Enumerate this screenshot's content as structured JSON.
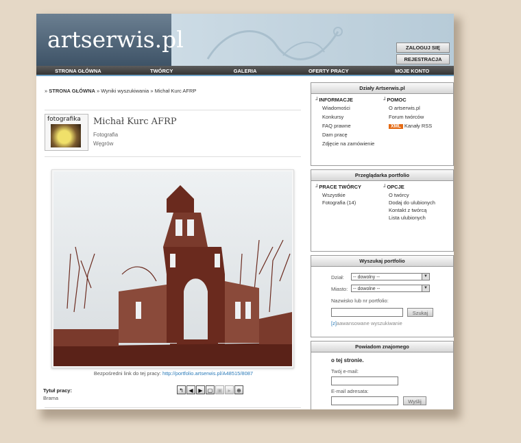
{
  "header": {
    "logo": "artserwis.pl",
    "login_button": "ZALOGUJ SIĘ",
    "register_button": "REJESTRACJA"
  },
  "nav": [
    "STRONA GŁÓWNA",
    "TWÓRCY",
    "GALERIA",
    "OFERTY PRACY",
    "MOJE KONTO"
  ],
  "breadcrumb": {
    "home": "STRONA GŁÓWNA",
    "results": "Wyniki wyszukiwania",
    "current": "Michał Kurc AFRP"
  },
  "profile": {
    "thumb_label": "fotografika",
    "name": "Michał Kurc AFRP",
    "category": "Fotografia",
    "city": "Węgrów"
  },
  "work": {
    "direct_link_label": "Bezpośredni link do tej pracy:",
    "direct_link_url": "http://portfolio.artserwis.pl/A48515/8087",
    "title_label": "Tytuł pracy:",
    "title_value": "Brama"
  },
  "sidebar": {
    "dzialy": {
      "title": "Działy Artserwis.pl",
      "informacje_header": "INFORMACJE",
      "informacje": [
        "Wiadomości",
        "Konkursy",
        "FAQ prawne",
        "Dam pracę",
        "Zdjęcie na zamówienie"
      ],
      "pomoc_header": "POMOC",
      "pomoc": [
        "O artserwis.pl",
        "Forum twórców"
      ],
      "xml_badge": "XML",
      "rss": "Kanały RSS"
    },
    "przegladarka": {
      "title": "Przeglądarka portfolio",
      "prace_header": "PRACE TWÓRCY",
      "prace": [
        "Wszystkie",
        "Fotografia (14)"
      ],
      "opcje_header": "OPCJE",
      "opcje": [
        "O twórcy",
        "Dodaj do ulubionych",
        "Kontakt z twórcą",
        "Lista ulubionych"
      ]
    },
    "wyszukaj": {
      "title": "Wyszukaj portfolio",
      "dzial_label": "Dział:",
      "dzial_value": "-- dowolny --",
      "miasto_label": "Miasto:",
      "miasto_value": "-- dowolne --",
      "nazwisko_label": "Nazwisko lub nr portfolio:",
      "szukaj_button": "Szukaj",
      "advanced_prefix": "[z]",
      "advanced_link": "aawansowane wyszukiwanie"
    },
    "powiadom": {
      "title": "Powiadom znajomego",
      "subtitle": "o tej stronie.",
      "your_email_label": "Twój e-mail:",
      "target_email_label": "E-mail adresata:",
      "send_button": "Wyślij"
    }
  }
}
